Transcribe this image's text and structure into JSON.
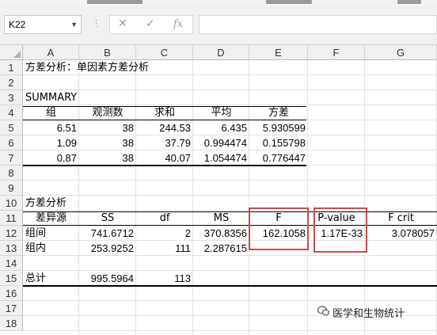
{
  "name_box": "K22",
  "fx_label": "fx",
  "column_headers": [
    "A",
    "B",
    "C",
    "D",
    "E",
    "F",
    "G"
  ],
  "row_headers": [
    "1",
    "2",
    "3",
    "4",
    "5",
    "6",
    "7",
    "8",
    "9",
    "10",
    "11",
    "12",
    "13",
    "14",
    "15",
    "16",
    "17",
    "18"
  ],
  "cells": {
    "title": "方差分析：单因素方差分析",
    "summary": "SUMMARY",
    "summary_headers": [
      "组",
      "观测数",
      "求和",
      "平均",
      "方差"
    ],
    "summary_rows": [
      [
        "6.51",
        "38",
        "244.53",
        "6.435",
        "5.930599"
      ],
      [
        "1.09",
        "38",
        "37.79",
        "0.994474",
        "0.155798"
      ],
      [
        "0.87",
        "38",
        "40.07",
        "1.054474",
        "0.776447"
      ]
    ],
    "anova_title": "方差分析",
    "anova_headers": [
      "差异源",
      "SS",
      "df",
      "MS",
      "F",
      "P-value",
      "F crit"
    ],
    "between": [
      "组间",
      "741.6712",
      "2",
      "370.8356",
      "162.1058",
      "1.17E-33",
      "3.078057"
    ],
    "within": [
      "组内",
      "253.9252",
      "111",
      "2.287615"
    ],
    "total": [
      "总计",
      "995.5964",
      "113"
    ]
  },
  "watermark": "医学和生物统计",
  "highlight_color": "#c0504d"
}
